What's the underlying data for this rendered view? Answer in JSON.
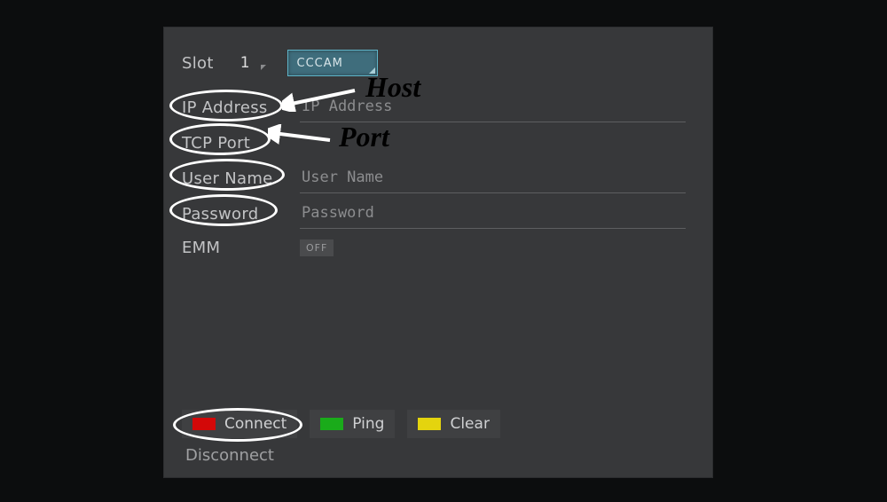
{
  "header": {
    "slot_label": "Slot",
    "slot_value": "1",
    "protocol": "CCCAM"
  },
  "fields": {
    "ip_label": "IP Address",
    "ip_placeholder": "IP Address",
    "ip_value": "",
    "port_label": "TCP Port",
    "port_value": "",
    "user_label": "User Name",
    "user_placeholder": "User Name",
    "user_value": "",
    "pass_label": "Password",
    "pass_placeholder": "Password",
    "pass_value": "",
    "emm_label": "EMM",
    "emm_state": "OFF"
  },
  "buttons": {
    "connect": "Connect",
    "ping": "Ping",
    "clear": "Clear",
    "disconnect": "Disconnect"
  },
  "annotations": {
    "host": "Host",
    "port": "Port"
  },
  "colors": {
    "red": "#d30808",
    "green": "#1aab1a",
    "yellow": "#e4d40e",
    "panel": "#37383a",
    "accent": "#3f6d7c"
  }
}
